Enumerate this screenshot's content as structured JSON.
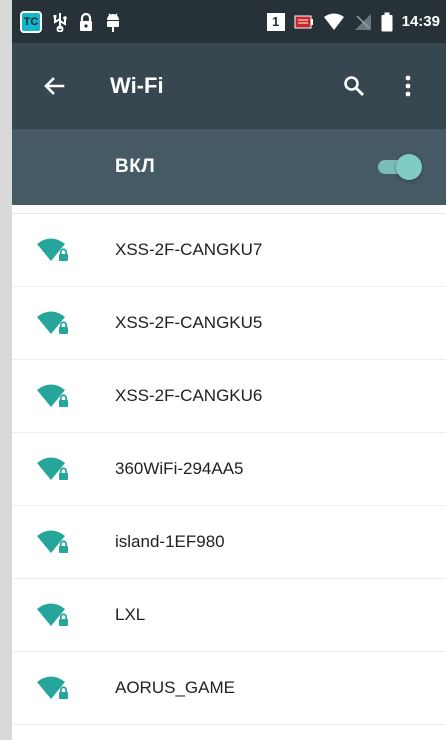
{
  "status_bar": {
    "app_badge": "TC",
    "sim_badge": "1",
    "time": "14:39"
  },
  "toolbar": {
    "title": "Wi-Fi"
  },
  "wifi_switch": {
    "label": "ВКЛ",
    "state": "on"
  },
  "networks": [
    {
      "name": "XSS-2F-CANGKU7",
      "secured": true
    },
    {
      "name": "XSS-2F-CANGKU5",
      "secured": true
    },
    {
      "name": "XSS-2F-CANGKU6",
      "secured": true
    },
    {
      "name": "360WiFi-294AA5",
      "secured": true
    },
    {
      "name": "island-1EF980",
      "secured": true
    },
    {
      "name": "LXL",
      "secured": true
    },
    {
      "name": "AORUS_GAME",
      "secured": true
    }
  ],
  "colors": {
    "status_bar": "#263238",
    "toolbar": "#37474f",
    "switch_bar": "#455a64",
    "accent": "#26a69a",
    "toggle_on": "#80cbc4"
  },
  "icons": {
    "back": "arrow-back-icon",
    "search": "search-icon",
    "overflow": "more-vert-icon",
    "wifi": "wifi-locked-icon"
  }
}
